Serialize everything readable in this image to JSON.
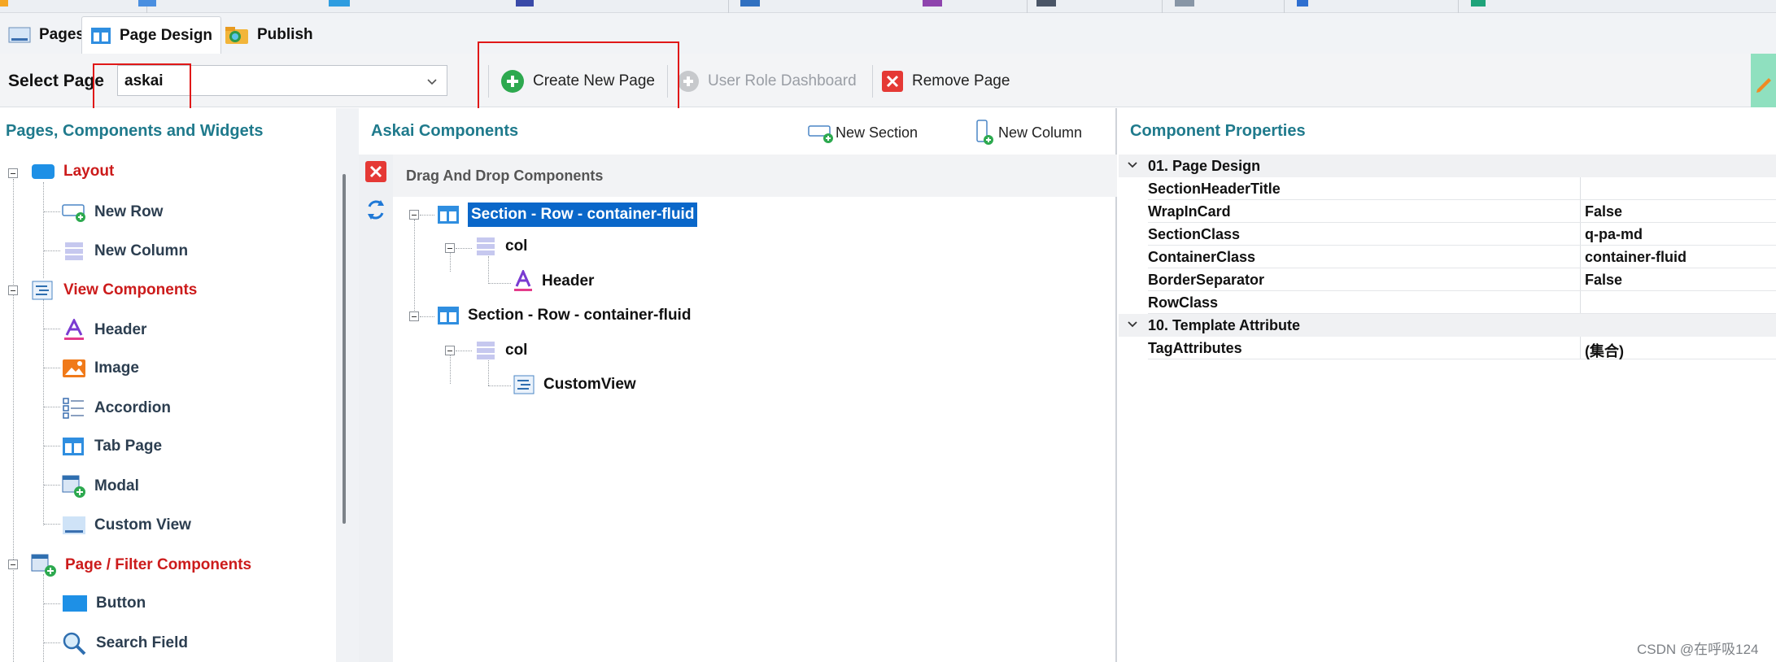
{
  "tabs": [
    {
      "label": "Pages"
    },
    {
      "label": "Page Design"
    },
    {
      "label": "Publish"
    }
  ],
  "toolbar": {
    "select_label": "Select Page",
    "select_value": "askai",
    "create_label": "Create New Page",
    "role_label": "User Role Dashboard",
    "remove_label": "Remove Page"
  },
  "left": {
    "title": "Pages, Components and Widgets",
    "categories": [
      {
        "label": "Layout",
        "items": [
          "New Row",
          "New Column"
        ]
      },
      {
        "label": "View Components",
        "items": [
          "Header",
          "Image",
          "Accordion",
          "Tab Page",
          "Modal",
          "Custom View"
        ]
      },
      {
        "label": "Page / Filter Components",
        "items": [
          "Button",
          "Search Field"
        ]
      }
    ]
  },
  "mid": {
    "title": "Askai Components",
    "new_section": "New Section",
    "new_column": "New Column",
    "dd_header": "Drag And Drop Components",
    "tree": [
      {
        "label": "Section - Row - container-fluid"
      },
      {
        "label": "col"
      },
      {
        "label": "Header"
      },
      {
        "label": "Section - Row - container-fluid"
      },
      {
        "label": "col"
      },
      {
        "label": "CustomView"
      }
    ]
  },
  "right": {
    "title": "Component Properties",
    "rows": [
      {
        "key": "01. Page Design",
        "value": ""
      },
      {
        "key": "SectionHeaderTitle",
        "value": ""
      },
      {
        "key": "WrapInCard",
        "value": "False"
      },
      {
        "key": "SectionClass",
        "value": "q-pa-md"
      },
      {
        "key": "ContainerClass",
        "value": "container-fluid"
      },
      {
        "key": "BorderSeparator",
        "value": "False"
      },
      {
        "key": "RowClass",
        "value": ""
      },
      {
        "key": "10. Template Attribute",
        "value": ""
      },
      {
        "key": "TagAttributes",
        "value": "(集合)"
      }
    ]
  },
  "watermark": "CSDN @在呼吸124",
  "colors": {
    "accent_title": "#1f7a8c",
    "category": "#cc1b1b",
    "selection": "#0a67c9",
    "highlight_box": "#e01818"
  }
}
